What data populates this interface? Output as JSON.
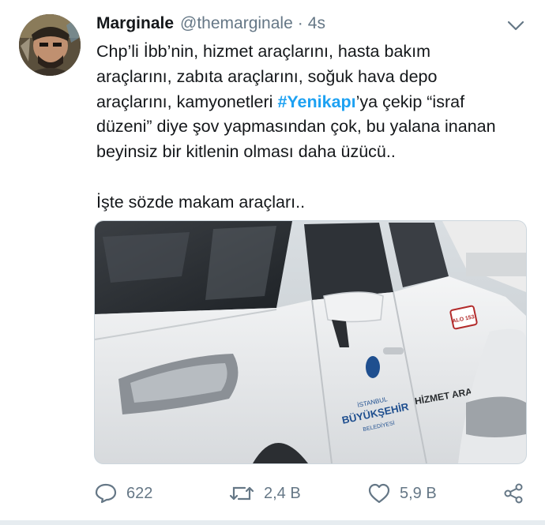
{
  "tweet": {
    "author_name": "Marginale",
    "handle": "@themarginale",
    "separator": "·",
    "time": "4s",
    "text_lines": [
      "Chp’li İbb’nin, hizmet araçlarını, hasta bakım",
      "araçlarını, zabıta araçlarını, soğuk hava depo"
    ],
    "line3_prefix": "araçlarını, kamyonetleri ",
    "hashtag": "#Yenikapı",
    "line3_suffix": "’ya çekip “israf",
    "text_lines_tail": [
      "düzeni” diye şov yapmasından çok, bu yalana inanan",
      "beyinsiz bir kitlenin olması daha üzücü.."
    ],
    "second_paragraph": "İşte sözde makam araçları..",
    "media": {
      "vehicle_label": "HİZMET ARACI",
      "logo_text_top": "İSTANBUL",
      "logo_text_main": "BÜYÜKŞEHİR",
      "logo_text_bottom": "BELEDİYESİ",
      "badge_text": "ALO 153"
    }
  },
  "actions": {
    "reply_count": "622",
    "retweet_count": "2,4 B",
    "like_count": "5,9 B"
  },
  "colors": {
    "text": "#14171a",
    "secondary": "#657786",
    "hashtag": "#1da1f2"
  }
}
